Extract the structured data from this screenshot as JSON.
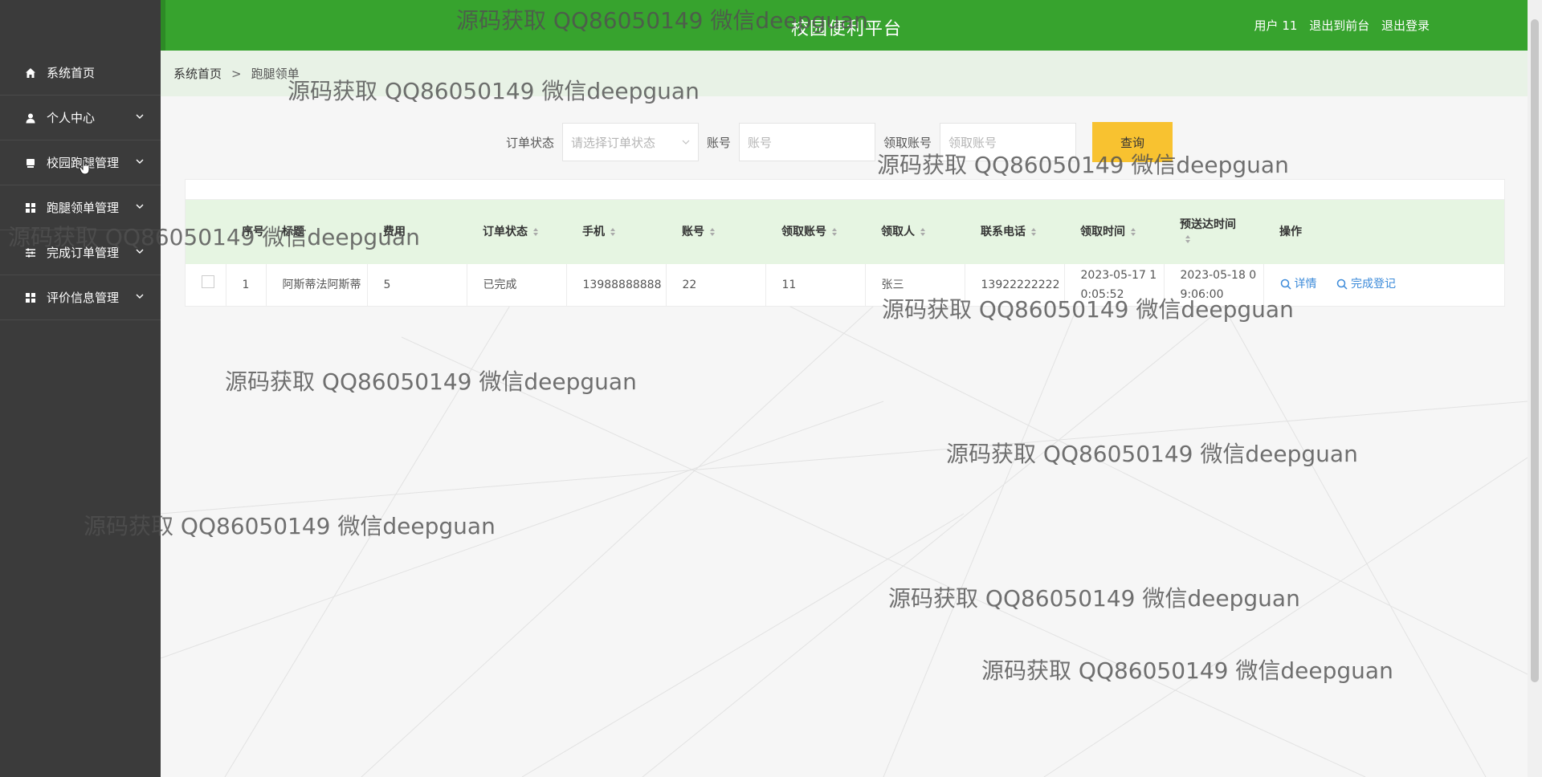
{
  "header": {
    "site_title": "校园便利平台",
    "user_label": "用户 11",
    "exit_front_label": "退出到前台",
    "logout_label": "退出登录"
  },
  "sidebar": {
    "items": [
      {
        "label": "系统首页",
        "icon": "home-icon"
      },
      {
        "label": "个人中心",
        "icon": "user-icon"
      },
      {
        "label": "校园跑腿管理",
        "icon": "box-icon"
      },
      {
        "label": "跑腿领单管理",
        "icon": "grid-icon"
      },
      {
        "label": "完成订单管理",
        "icon": "sliders-icon"
      },
      {
        "label": "评价信息管理",
        "icon": "grid-icon"
      }
    ]
  },
  "breadcrumb": {
    "home": "系统首页",
    "separator": ">",
    "current": "跑腿领单"
  },
  "search": {
    "status_label": "订单状态",
    "status_placeholder": "请选择订单状态",
    "account_label": "账号",
    "account_placeholder": "账号",
    "receiver_label": "领取账号",
    "receiver_placeholder": "领取账号",
    "query_label": "查询"
  },
  "table": {
    "headers": [
      "序号",
      "标题",
      "费用",
      "订单状态",
      "手机",
      "账号",
      "领取账号",
      "领取人",
      "联系电话",
      "领取时间",
      "预送达时间",
      "操作"
    ],
    "rows": [
      {
        "index": "1",
        "title": "阿斯蒂法阿斯蒂",
        "fee": "5",
        "status": "已完成",
        "phone": "13988888888",
        "account": "22",
        "receiver_account": "11",
        "receiver": "张三",
        "contact": "13922222222",
        "receive_time": "2023-05-17 10:05:52",
        "eta": "2023-05-18 09:06:00",
        "detail_label": "详情",
        "complete_label": "完成登记"
      }
    ]
  },
  "watermark_text": "源码获取 QQ86050149 微信deepguan",
  "colors": {
    "primary_green": "#37a32e",
    "sidebar_bg": "#3b3b3b",
    "query_button": "#f8c230",
    "link_blue": "#3b8ad9"
  }
}
